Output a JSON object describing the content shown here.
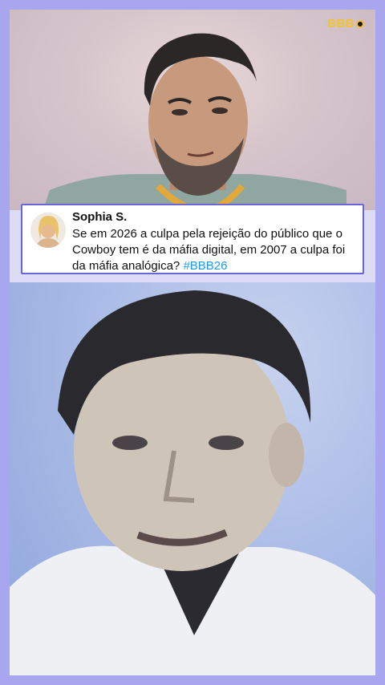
{
  "logo": {
    "text": "BBB"
  },
  "tweet": {
    "author": "Sophia S.",
    "text": "Se em 2026 a culpa pela rejeição do público que o Cowboy tem é da máfia digital, em 2007 a culpa foi da máfia analógica?",
    "hashtag": "#BBB26"
  },
  "colors": {
    "border": "#a9a6f0",
    "card_border": "#6b66d8",
    "hashtag": "#1d9bf0",
    "logo": "#f2c230"
  }
}
